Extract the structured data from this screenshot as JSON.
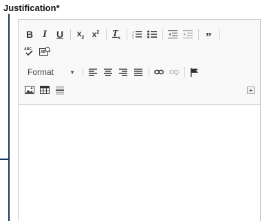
{
  "field": {
    "label": "Justification*"
  },
  "toolbar": {
    "format_label": "Format",
    "colors": {
      "icon": "#333333",
      "separator": "#cfcfcf",
      "accent": "#17355f"
    }
  },
  "editor": {
    "content": ""
  }
}
